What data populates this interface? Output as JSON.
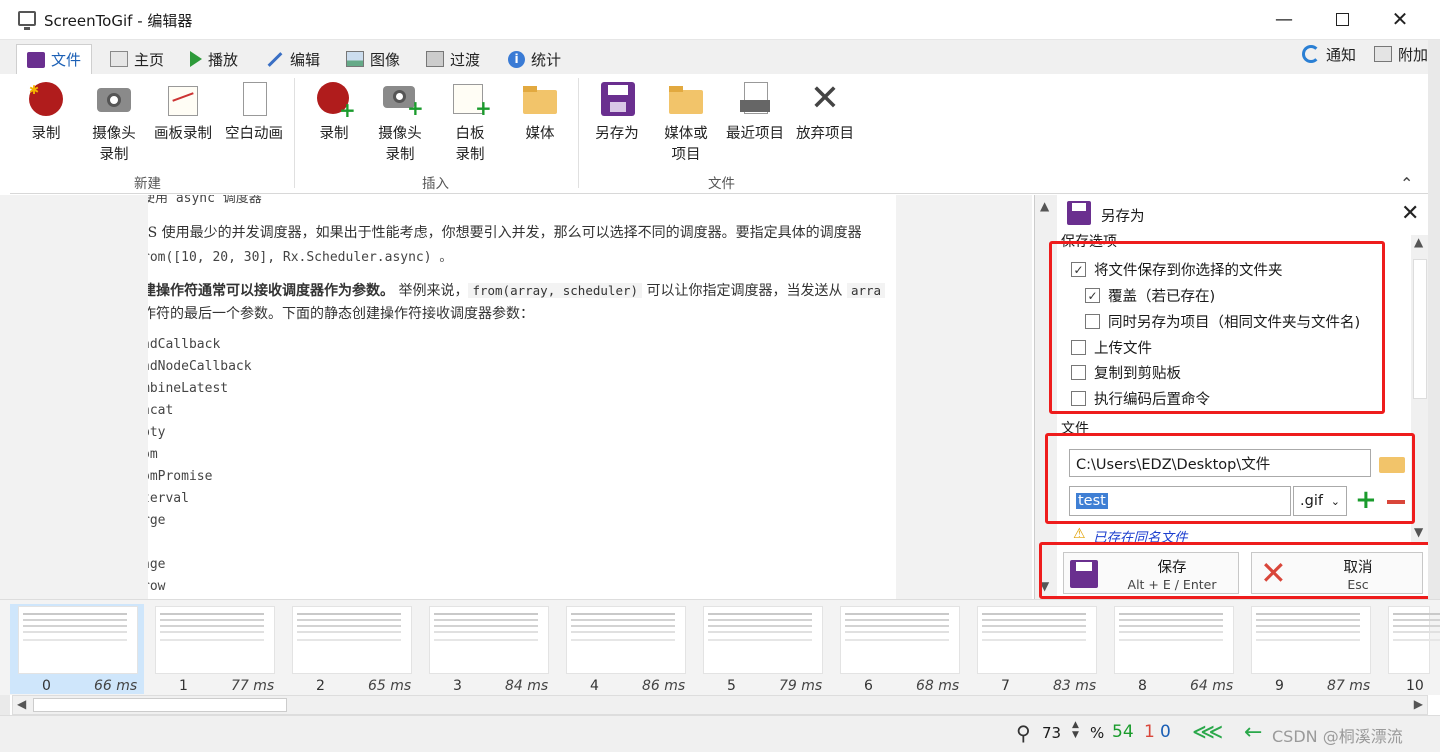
{
  "window": {
    "title": "ScreenToGif - 编辑器"
  },
  "tabs": [
    {
      "label": "文件"
    },
    {
      "label": "主页"
    },
    {
      "label": "播放"
    },
    {
      "label": "编辑"
    },
    {
      "label": "图像"
    },
    {
      "label": "过渡"
    },
    {
      "label": "统计"
    }
  ],
  "tabs_right": {
    "notify": "通知",
    "extra": "附加"
  },
  "ribbon": {
    "groups": {
      "new": "新建",
      "insert": "插入",
      "file": "文件"
    },
    "new": {
      "record": "录制",
      "webcam_l1": "摄像头",
      "webcam_l2": "录制",
      "board": "画板录制",
      "blank": "空白动画"
    },
    "insert": {
      "record": "录制",
      "webcam_l1": "摄像头",
      "webcam_l2": "录制",
      "board_l1": "白板",
      "board_l2": "录制",
      "media": "媒体"
    },
    "file": {
      "save_as": "另存为",
      "media_l1": "媒体或",
      "media_l2": "项目",
      "recent": "最近项目",
      "discard": "放弃项目"
    }
  },
  "doc": {
    "l0": "使用 async 调度器",
    "l1": "JS 使用最少的并发调度器，如果出于性能考虑，你想要引入并发，那么可以选择不同的调度器。要指定具体的调度器",
    "l2": "rom([10, 20, 30], Rx.Scheduler.async) 。",
    "l3_bold": "建操作符通常可以接收调度器作为参数。",
    "l3_a": " 举例来说，",
    "l3_code": "from(array, scheduler)",
    "l3_b": " 可以让你指定调度器，当发送从 ",
    "l3_code2": "arra",
    "l4": "作符的最后一个参数。下面的静态创建操作符接收调度器参数：",
    "ops": [
      "ndCallback",
      "ndNodeCallback",
      "mbineLatest",
      "ncat",
      "pty",
      "om",
      "omPromise",
      "terval",
      "rge",
      "",
      "nge",
      "row"
    ]
  },
  "panel": {
    "title": "另存为",
    "save_options": "保存选项",
    "opts": {
      "save_folder": "将文件保存到你选择的文件夹",
      "overwrite": "覆盖（若已存在)",
      "save_project": "同时另存为项目（相同文件夹与文件名)",
      "upload": "上传文件",
      "copy_clip": "复制到剪贴板",
      "post_cmd": "执行编码后置命令"
    },
    "file_label": "文件",
    "folder_value": "C:\\Users\\EDZ\\Desktop\\文件",
    "filename_value": "test",
    "ext_value": ".gif",
    "warn_text": "已存在同名文件",
    "save_label": "保存",
    "save_hint": "Alt + E / Enter",
    "cancel_label": "取消",
    "cancel_hint": "Esc"
  },
  "frames": [
    {
      "n": "0",
      "ms": "66 ms"
    },
    {
      "n": "1",
      "ms": "77 ms"
    },
    {
      "n": "2",
      "ms": "65 ms"
    },
    {
      "n": "3",
      "ms": "84 ms"
    },
    {
      "n": "4",
      "ms": "86 ms"
    },
    {
      "n": "5",
      "ms": "79 ms"
    },
    {
      "n": "6",
      "ms": "68 ms"
    },
    {
      "n": "7",
      "ms": "83 ms"
    },
    {
      "n": "8",
      "ms": "64 ms"
    },
    {
      "n": "9",
      "ms": "87 ms"
    },
    {
      "n": "10",
      "ms": ""
    }
  ],
  "status": {
    "zoom": "73",
    "pct": "%",
    "count_total": "54",
    "count_sel": "1",
    "count_x": "0",
    "watermark": "CSDN @桐溪漂流"
  },
  "colors": {
    "accent": "#1b5fb5",
    "highlight": "#ee1c1c",
    "green": "#1a9b2c"
  }
}
